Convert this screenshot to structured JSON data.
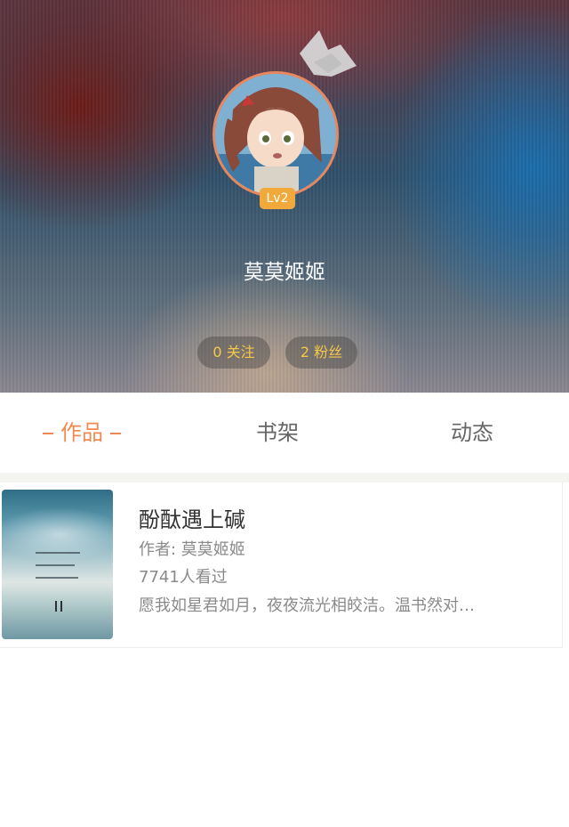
{
  "profile": {
    "level_badge": "Lv2",
    "username": "莫莫姬姬",
    "follow_pill": "0 关注",
    "fans_pill": "2 粉丝"
  },
  "tabs": [
    {
      "label": "作品",
      "active": true
    },
    {
      "label": "书架",
      "active": false
    },
    {
      "label": "动态",
      "active": false
    }
  ],
  "works": [
    {
      "title": "酚酞遇上碱",
      "author": "作者: 莫莫姬姬",
      "views": "7741人看过",
      "description": "愿我如星君如月，夜夜流光相皎洁。温书然对…"
    }
  ],
  "colors": {
    "accent": "#ef8a52",
    "avatar_ring": "#e7875e",
    "level_badge": "#f2a93b",
    "pill_text": "#f4c84a"
  },
  "icons": {
    "crown": "crown-icon"
  }
}
